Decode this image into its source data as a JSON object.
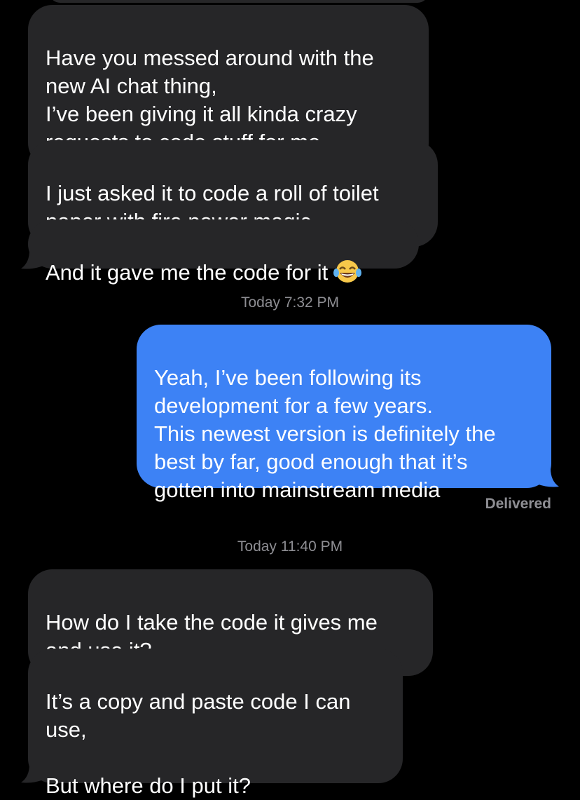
{
  "thread": {
    "messages": [
      {
        "direction": "incoming",
        "text": "Have you messed around with the\nnew AI chat thing,\n I’ve been giving it all kinda crazy\nrequests to code stuff for me"
      },
      {
        "direction": "incoming",
        "text": "I just asked it to code a roll of toilet\npaper with fire power magic"
      },
      {
        "direction": "incoming",
        "text": "And it gave me the code for it",
        "emoji": "face-with-tears-of-joy"
      },
      {
        "direction": "outgoing",
        "text": "Yeah, I’ve been following its\ndevelopment for a few years.\nThis newest version is definitely the\nbest by far, good enough that it’s\ngotten into mainstream media"
      },
      {
        "direction": "incoming",
        "text": "How do I take the code it gives me\nand use it?"
      },
      {
        "direction": "incoming",
        "text": "It’s a copy and paste code I can\nuse,\n\n But where do I put it?"
      }
    ],
    "timestamps": [
      "Today 7:32 PM",
      "Today 11:40 PM"
    ],
    "delivery_status": "Delivered",
    "colors": {
      "background": "#000000",
      "incoming_bubble": "#262628",
      "outgoing_bubble": "#3d82f5",
      "timestamp_text": "#8e8e93"
    }
  }
}
